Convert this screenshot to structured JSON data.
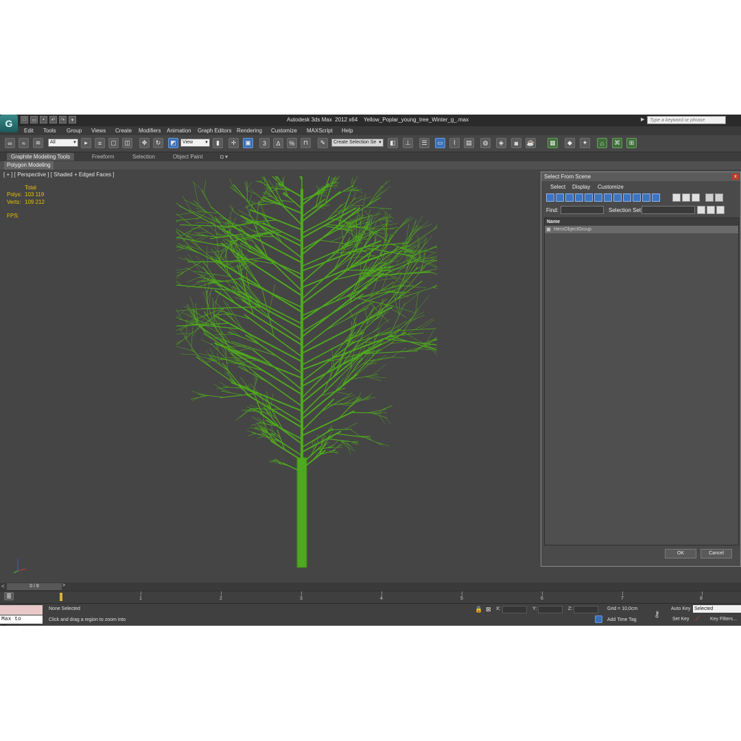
{
  "window": {
    "title_app": "Autodesk 3ds Max  2012 x64",
    "title_file": "Yellow_Poplar_young_tree_Winter_g_.max",
    "search_placeholder": "Type a keyword or phrase",
    "logo_glyph": "G"
  },
  "menu": [
    "Edit",
    "Tools",
    "Group",
    "Views",
    "Create",
    "Modifiers",
    "Animation",
    "Graph Editors",
    "Rendering",
    "Customize",
    "MAXScript",
    "Help"
  ],
  "toolbar": {
    "filter_value": "All",
    "ref_coord_value": "View",
    "snap_label": "3",
    "angle_snap_label": "%",
    "named_selection_placeholder": "Create Selection Se"
  },
  "ribbon": {
    "tabs": [
      "Graphite Modeling Tools",
      "Freeform",
      "Selection",
      "Object Paint"
    ],
    "active_tab": "Graphite Modeling Tools",
    "panel_button": "Polygon Modeling"
  },
  "viewport": {
    "label": "[ + ] [ Perspective ] [ Shaded + Edged Faces ]",
    "stats_header": "Total",
    "polys_label": "Polys:",
    "polys_value": "103 119",
    "verts_label": "Verts:",
    "verts_value": "109 212",
    "fps_label": "FPS:",
    "tree_color": "#4fa81e"
  },
  "dialog": {
    "title": "Select From Scene",
    "close_glyph": "x",
    "menu": [
      "Select",
      "Display",
      "Customize"
    ],
    "find_label": "Find:",
    "selection_set_label": "Selection Set:",
    "list_header": "Name",
    "items": [
      "HeroObjectGroup"
    ],
    "ok_label": "OK",
    "cancel_label": "Cancel"
  },
  "timeline": {
    "frame_display": "0 / 8",
    "left_arrow": "<",
    "right_arrow": ">",
    "ticks": [
      "1",
      "2",
      "3",
      "4",
      "5",
      "6",
      "7",
      "8"
    ]
  },
  "status": {
    "maxscript_text": "Max to Physc.",
    "selection_status": "None Selected",
    "prompt": "Click and drag a region to zoom into",
    "x_label": "X:",
    "y_label": "Y:",
    "z_label": "Z:",
    "grid": "Grid = 10,0cm",
    "add_time_tag": "Add Time Tag",
    "auto_key": "Auto Key",
    "set_key": "Set Key",
    "selected_value": "Selected",
    "key_filters": "Key Filters..."
  }
}
